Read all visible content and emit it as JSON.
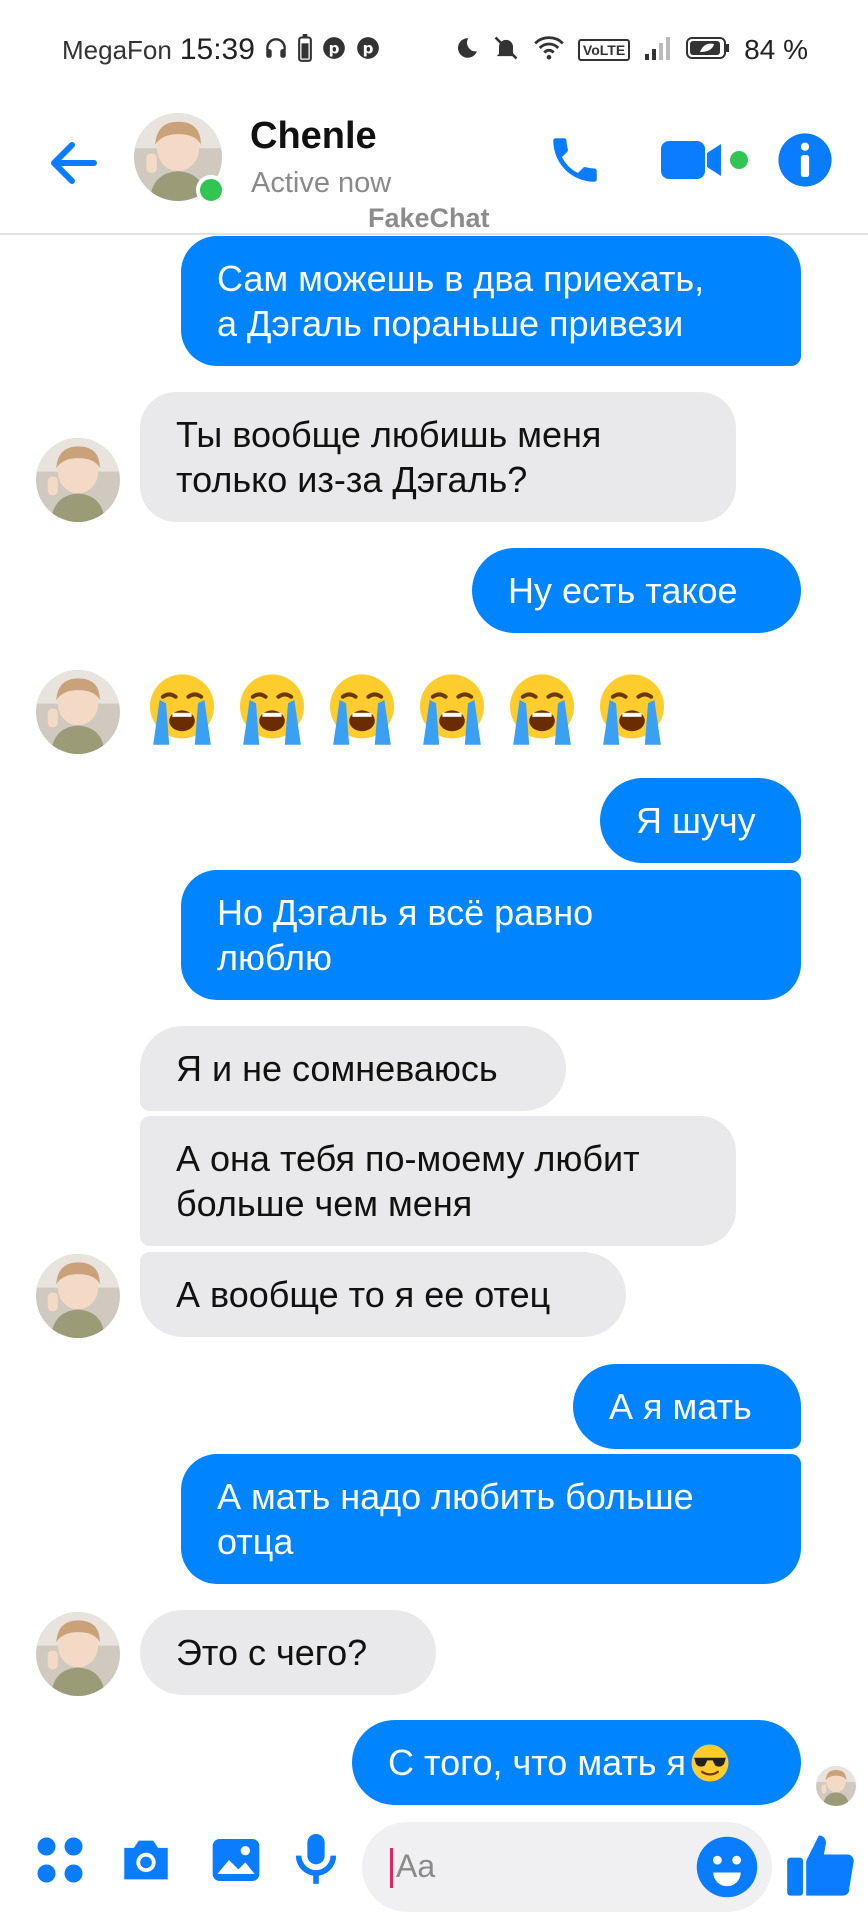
{
  "status_bar": {
    "carrier": "MegaFon",
    "time": "15:39",
    "volte": "VoLTE",
    "battery": "84 %"
  },
  "header": {
    "contact_name": "Chenle",
    "contact_status": "Active now",
    "watermark": "FakeChat"
  },
  "messages": [
    {
      "side": "out",
      "text_lines": [
        "Сам можешь в два приехать,",
        "а Дэгаль пораньше привези"
      ]
    },
    {
      "side": "in",
      "text_lines": [
        "Ты вообще любишь меня",
        "только из-за Дэгаль?"
      ]
    },
    {
      "side": "out",
      "text_lines": [
        "Ну есть такое"
      ]
    },
    {
      "side": "in",
      "emoji_count": 6,
      "emoji": "loudly-crying-face"
    },
    {
      "side": "out",
      "text_lines": [
        "Я шучу"
      ]
    },
    {
      "side": "out",
      "text_lines": [
        "Но Дэгаль я всё равно",
        "люблю"
      ]
    },
    {
      "side": "in",
      "text_lines": [
        "Я и не сомневаюсь"
      ]
    },
    {
      "side": "in",
      "text_lines": [
        "А она тебя по-моему любит",
        "больше чем меня"
      ]
    },
    {
      "side": "in",
      "text_lines": [
        "А вообще то я ее отец"
      ]
    },
    {
      "side": "out",
      "text_lines": [
        "А я мать"
      ]
    },
    {
      "side": "out",
      "text_lines": [
        "А мать надо любить больше",
        "отца"
      ]
    },
    {
      "side": "in",
      "text_lines": [
        "Это с чего?"
      ]
    },
    {
      "side": "out",
      "text_lines": [
        "С того, что мать я"
      ],
      "trailing_emoji": "smiling-face-with-sunglasses"
    }
  ],
  "composer": {
    "placeholder": "Aa"
  },
  "colors": {
    "accent": "#0084ff",
    "incoming_bubble": "#e9e9eb",
    "online": "#31c553"
  },
  "icons": {
    "back": "arrow-left-icon",
    "call": "phone-icon",
    "video": "video-camera-icon",
    "info": "info-icon",
    "menu": "four-dots-icon",
    "camera": "camera-icon",
    "gallery": "image-icon",
    "mic": "microphone-icon",
    "emoji": "smiley-icon",
    "like": "thumbs-up-icon"
  }
}
